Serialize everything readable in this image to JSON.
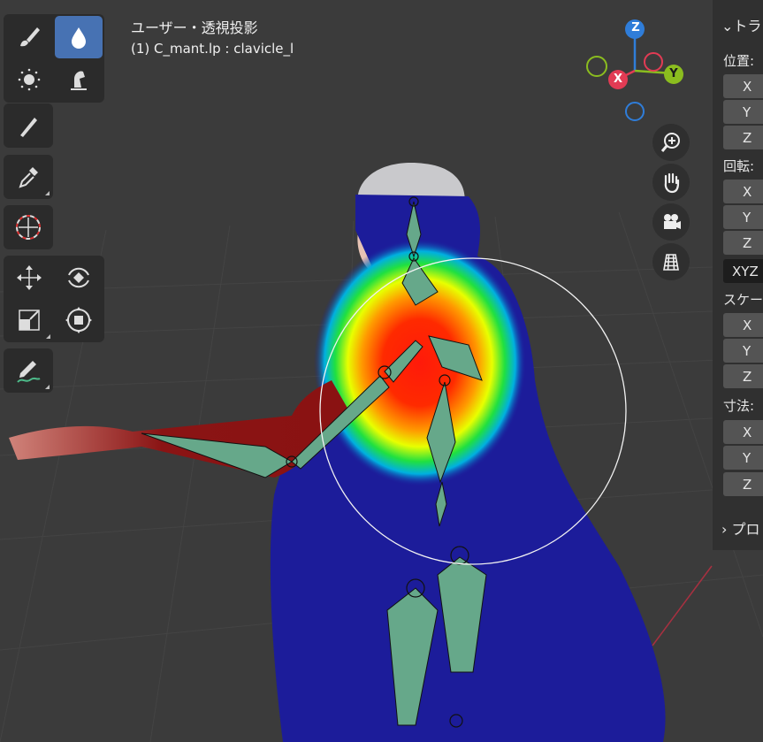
{
  "viewport": {
    "title": "ユーザー・透視投影",
    "object_info": "(1) C_mant.lp : clavicle_l"
  },
  "toolbar": {
    "tools": [
      {
        "name": "draw-brush",
        "icon": "brush-icon",
        "active": false
      },
      {
        "name": "weight-drop",
        "icon": "drop-icon",
        "active": true
      },
      {
        "name": "blur",
        "icon": "blur-icon",
        "active": false
      },
      {
        "name": "smear",
        "icon": "smear-icon",
        "active": false
      },
      {
        "name": "gradient",
        "icon": "gradient-icon",
        "active": false
      },
      {
        "name": "sample",
        "icon": "eyedropper-icon",
        "active": false
      },
      {
        "name": "cursor",
        "icon": "cursor-icon",
        "active": false
      },
      {
        "name": "move",
        "icon": "move-icon",
        "active": false
      },
      {
        "name": "rotate",
        "icon": "rotate-icon",
        "active": false
      },
      {
        "name": "scale",
        "icon": "scale-icon",
        "active": false
      },
      {
        "name": "transform",
        "icon": "transform-icon",
        "active": false
      },
      {
        "name": "annotate",
        "icon": "annotate-icon",
        "active": false
      }
    ]
  },
  "gizmo": {
    "z": "Z",
    "x": "X",
    "y": "Y",
    "colors": {
      "x": "#e23b54",
      "y": "#8bbd1f",
      "z": "#2f7dd9"
    }
  },
  "nav_buttons": [
    "zoom-icon",
    "hand-icon",
    "camera-icon",
    "grid-icon"
  ],
  "npanel": {
    "transform_header": "トラ",
    "location_label": "位置:",
    "rotation_label": "回転:",
    "scale_label": "スケー",
    "dimensions_label": "寸法:",
    "mode": "XYZ",
    "axes": [
      "X",
      "Y",
      "Z"
    ],
    "properties_header": "プロ"
  }
}
